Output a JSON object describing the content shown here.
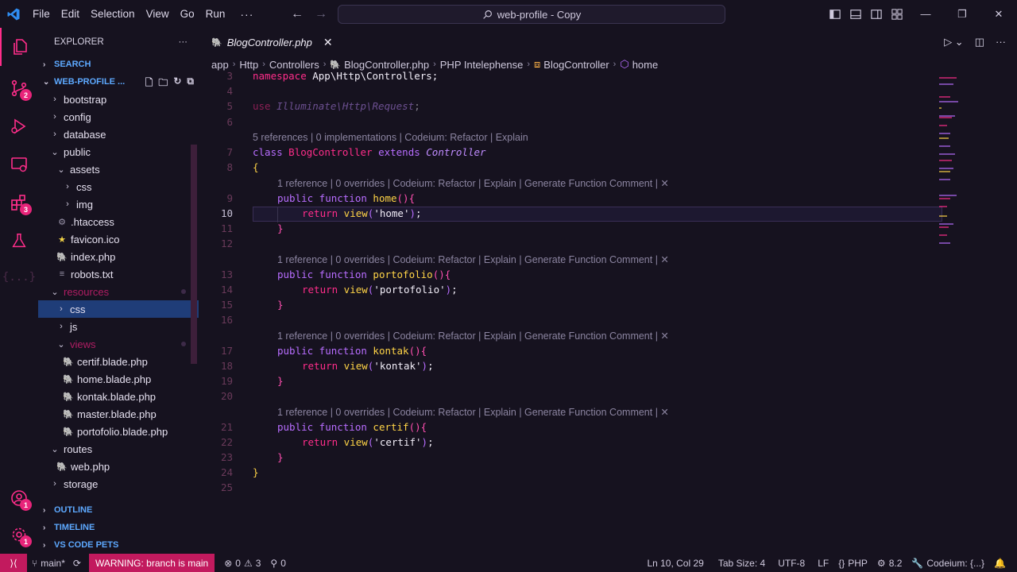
{
  "titlebar": {
    "menu": [
      "File",
      "Edit",
      "Selection",
      "View",
      "Go",
      "Run"
    ],
    "more": "···",
    "search_text": "web-profile - Copy"
  },
  "activity": {
    "source_control_badge": "2",
    "extensions_badge": "3",
    "accounts_badge": "1",
    "manage_badge": "1"
  },
  "sidebar": {
    "title": "EXPLORER",
    "more": "···",
    "search_section": "SEARCH",
    "project": "WEB-PROFILE ...",
    "tree": [
      {
        "label": "bootstrap",
        "type": "folder",
        "depth": 1,
        "open": false
      },
      {
        "label": "config",
        "type": "folder",
        "depth": 1,
        "open": false
      },
      {
        "label": "database",
        "type": "folder",
        "depth": 1,
        "open": false
      },
      {
        "label": "public",
        "type": "folder",
        "depth": 1,
        "open": true
      },
      {
        "label": "assets",
        "type": "folder",
        "depth": 2,
        "open": true
      },
      {
        "label": "css",
        "type": "folder",
        "depth": 3,
        "open": false
      },
      {
        "label": "img",
        "type": "folder",
        "depth": 3,
        "open": false
      },
      {
        "label": ".htaccess",
        "type": "gear",
        "depth": 2
      },
      {
        "label": "favicon.ico",
        "type": "star",
        "depth": 2
      },
      {
        "label": "index.php",
        "type": "php",
        "depth": 2
      },
      {
        "label": "robots.txt",
        "type": "lines",
        "depth": 2
      },
      {
        "label": "resources",
        "type": "folder",
        "depth": 1,
        "open": true,
        "dim": true
      },
      {
        "label": "css",
        "type": "folder",
        "depth": 2,
        "open": false,
        "selected": true
      },
      {
        "label": "js",
        "type": "folder",
        "depth": 2,
        "open": false
      },
      {
        "label": "views",
        "type": "folder",
        "depth": 2,
        "open": true,
        "dim": true
      },
      {
        "label": "certif.blade.php",
        "type": "php",
        "depth": 3
      },
      {
        "label": "home.blade.php",
        "type": "php",
        "depth": 3
      },
      {
        "label": "kontak.blade.php",
        "type": "php",
        "depth": 3
      },
      {
        "label": "master.blade.php",
        "type": "php",
        "depth": 3
      },
      {
        "label": "portofolio.blade.php",
        "type": "php",
        "depth": 3
      },
      {
        "label": "routes",
        "type": "folder",
        "depth": 1,
        "open": true
      },
      {
        "label": "web.php",
        "type": "php",
        "depth": 2
      },
      {
        "label": "storage",
        "type": "folder",
        "depth": 1,
        "open": false
      }
    ],
    "outline": "OUTLINE",
    "timeline": "TIMELINE",
    "pets": "VS CODE PETS"
  },
  "editor": {
    "tab_label": "BlogController.php",
    "breadcrumb": [
      "app",
      "Http",
      "Controllers",
      "BlogController.php",
      "PHP Intelephense",
      "BlogController",
      "home"
    ],
    "lens_class": "5 references | 0 implementations | Codeium: Refactor | Explain",
    "lens_method": "1 reference | 0 overrides | Codeium: Refactor | Explain | Generate Function Comment | ✕",
    "line_numbers": [
      "3",
      "4",
      "5",
      "6",
      "7",
      "8",
      "9",
      "10",
      "11",
      "12",
      "13",
      "14",
      "15",
      "16",
      "17",
      "18",
      "19",
      "20",
      "21",
      "22",
      "23",
      "24",
      "25"
    ],
    "current_line": "10",
    "code": {
      "ns_kw": "namespace",
      "ns_val": " App\\Http\\Controllers;",
      "use_kw": "use",
      "use_path": " Illuminate\\Http\\",
      "use_cls": "Request",
      "use_end": ";",
      "class_kw": "class",
      "class_name": " BlogController ",
      "extends_kw": "extends",
      "parent": " Controller",
      "open_brace": "{",
      "close_brace": "}",
      "public_kw": "public",
      "function_kw": " function ",
      "return_kw": "return",
      "view_fn": " view",
      "methods": [
        "home",
        "portofolio",
        "kontak",
        "certif"
      ],
      "views": [
        "'home'",
        "'portofolio'",
        "'kontak'",
        "'certif'"
      ]
    }
  },
  "status": {
    "branch": "main*",
    "warning": "WARNING: branch is main",
    "errors": "0",
    "warnings": "3",
    "ports": "0",
    "position": "Ln 10, Col 29",
    "tab_size": "Tab Size: 4",
    "encoding": "UTF-8",
    "eol": "LF",
    "language": "PHP",
    "php_version": "8.2",
    "codeium": "Codeium: {...}"
  },
  "colors": {
    "accent": "#ff2d8a",
    "keyword_purple": "#b86dff",
    "function_yellow": "#ffd447",
    "selection": "#1f3d78",
    "status_warning_bg": "#c21a5e"
  },
  "icons": {
    "explorer": "files-icon",
    "search": "search-icon",
    "source_control": "source-control-icon",
    "run": "run-debug-icon",
    "remote": "remote-explorer-icon",
    "extensions": "extensions-icon",
    "testing": "flask-icon",
    "json": "braces-icon",
    "accounts": "account-icon",
    "manage": "gear-icon"
  }
}
